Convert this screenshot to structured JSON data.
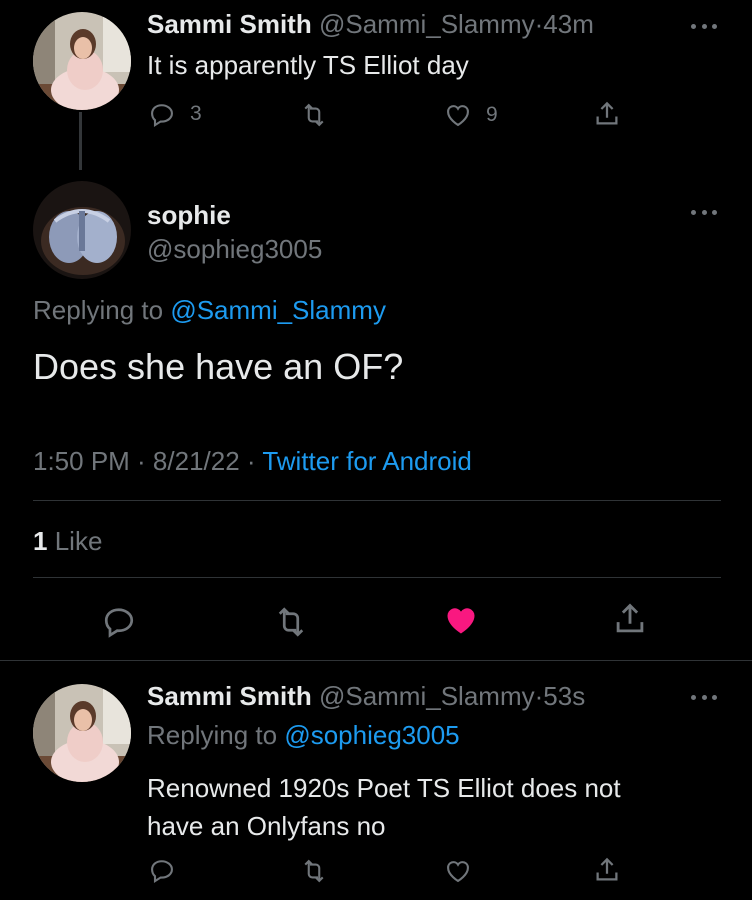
{
  "tweet1": {
    "name": "Sammi Smith",
    "handle": "@Sammi_Slammy",
    "sep": "·",
    "time": "43m",
    "text": "It is apparently TS Elliot day",
    "reply_count": "3",
    "like_count": "9"
  },
  "main": {
    "name": "sophie",
    "handle": "@sophieg3005",
    "replying_prefix": "Replying to",
    "replying_handle": "@Sammi_Slammy",
    "text": "Does she have an OF?",
    "timestamp": "1:50 PM · 8/21/22 ·",
    "source": "Twitter for Android",
    "like_stat_num": "1",
    "like_stat_label": "Like",
    "heart_color": "#f91880"
  },
  "reply": {
    "name": "Sammi Smith",
    "handle": "@Sammi_Slammy",
    "sep": "·",
    "time": "53s",
    "replying_prefix": "Replying to",
    "replying_handle": "@sophieg3005",
    "text_line1": "Renowned 1920s Poet TS Elliot does not",
    "text_line2": "have an Onlyfans no"
  },
  "colors": {
    "background": "#000000",
    "text": "#e7e9ea",
    "muted": "#71767b",
    "link": "#1d9bf0",
    "like": "#f91880"
  }
}
